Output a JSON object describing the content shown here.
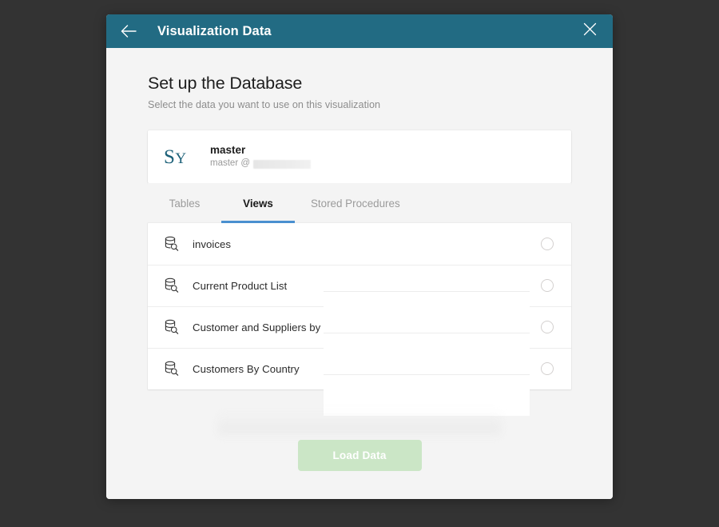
{
  "window": {
    "background_color": "#333333"
  },
  "titlebar": {
    "title": "Visualization Data",
    "background_color": "#226b83",
    "back_icon": "arrow-left-icon",
    "close_icon": "close-icon"
  },
  "page": {
    "heading": "Set up the Database",
    "subheading": "Select the data you want to use on this visualization"
  },
  "connection": {
    "logo_main": "S",
    "logo_sub": "Y",
    "logo_color": "#1d6179",
    "name": "master",
    "detail_prefix": "master @",
    "detail_redacted": true
  },
  "tabs": {
    "active_index": 1,
    "accent_color": "#4a90d0",
    "items": [
      {
        "label": "Tables",
        "active": false
      },
      {
        "label": "Views",
        "active": true
      },
      {
        "label": "Stored Procedures",
        "active": false
      }
    ]
  },
  "list": {
    "icon": "database-view-icon",
    "items": [
      {
        "label": "invoices",
        "selected": false
      },
      {
        "label": "Current Product List",
        "selected": false
      },
      {
        "label": "Customer and Suppliers by City",
        "selected": false
      },
      {
        "label": "Customers By Country",
        "selected": false
      }
    ]
  },
  "footer": {
    "load_button_label": "Load Data",
    "load_button_color": "#cbe6c6",
    "load_button_enabled": false
  }
}
